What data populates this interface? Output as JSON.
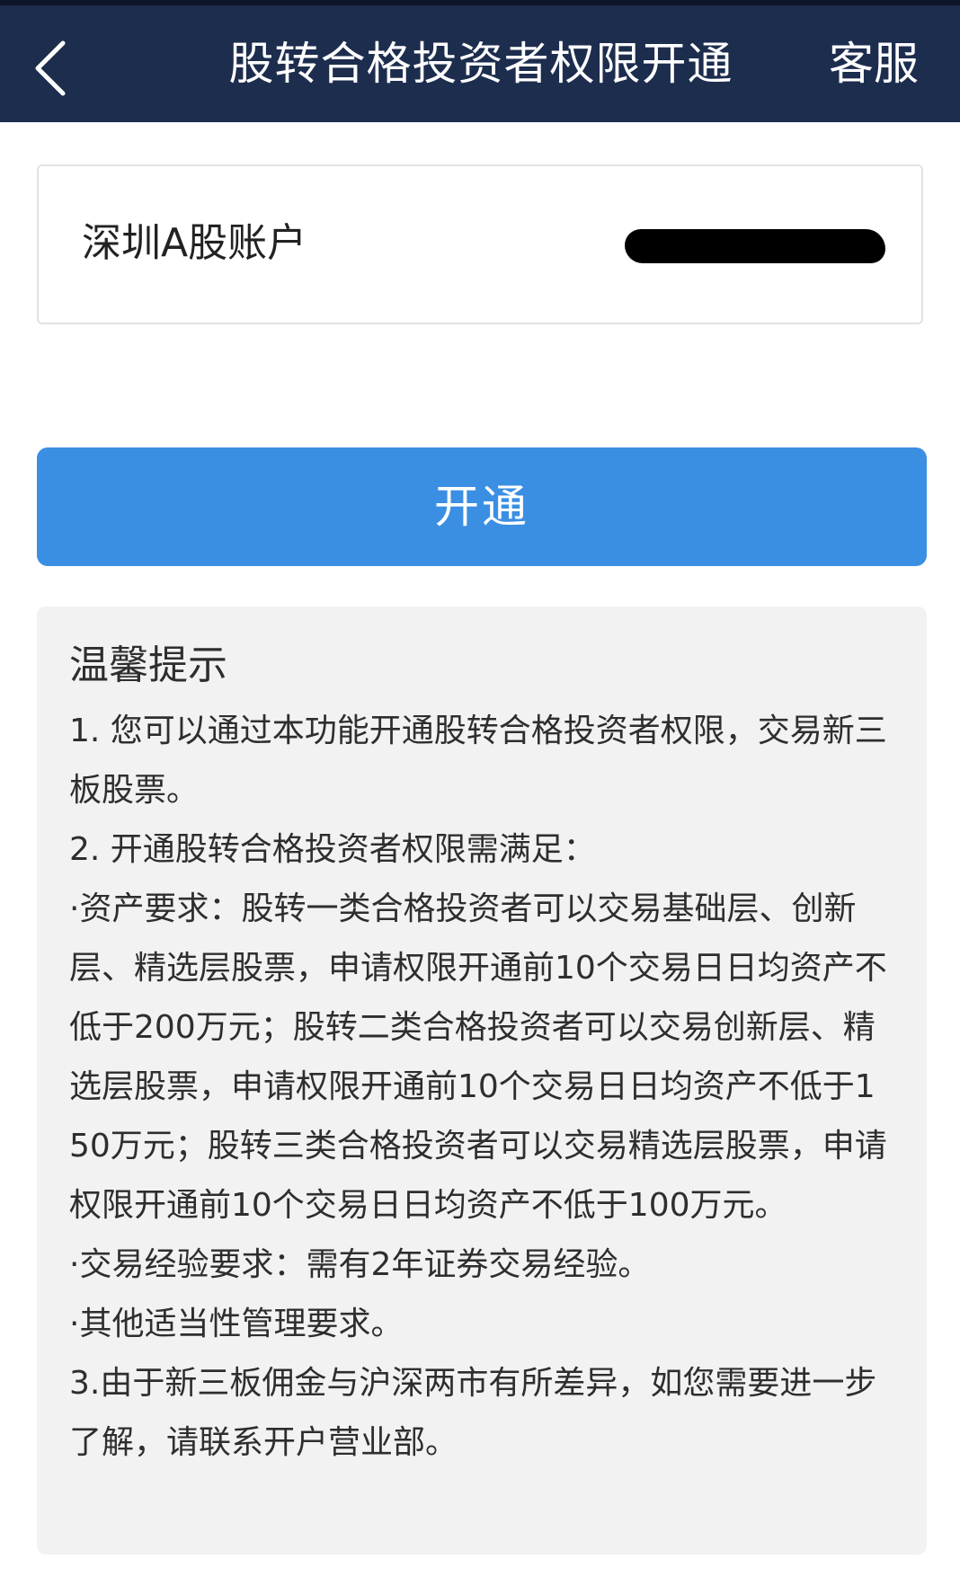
{
  "header": {
    "back_icon": "chevron-left-icon",
    "title": "股转合格投资者权限开通",
    "service_label": "客服"
  },
  "account": {
    "label": "深圳A股账户",
    "value_redacted": true
  },
  "action": {
    "open_label": "开通"
  },
  "tips": {
    "title": "温馨提示",
    "lines": [
      "1. 您可以通过本功能开通股转合格投资者权限，交易新三板股票。",
      "2. 开通股转合格投资者权限需满足：",
      "·资产要求：股转一类合格投资者可以交易基础层、创新层、精选层股票，申请权限开通前10个交易日日均资产不低于200万元；股转二类合格投资者可以交易创新层、精选层股票，申请权限开通前10个交易日日均资产不低于150万元；股转三类合格投资者可以交易精选层股票，申请权限开通前10个交易日日均资产不低于100万元。",
      "·交易经验要求：需有2年证券交易经验。",
      "·其他适当性管理要求。",
      "3.由于新三板佣金与沪深两市有所差异，如您需要进一步了解，请联系开户营业部。"
    ]
  },
  "colors": {
    "header_bg": "#1d2d4e",
    "button_bg": "#3b8fe3",
    "tips_bg": "#f2f2f2"
  }
}
